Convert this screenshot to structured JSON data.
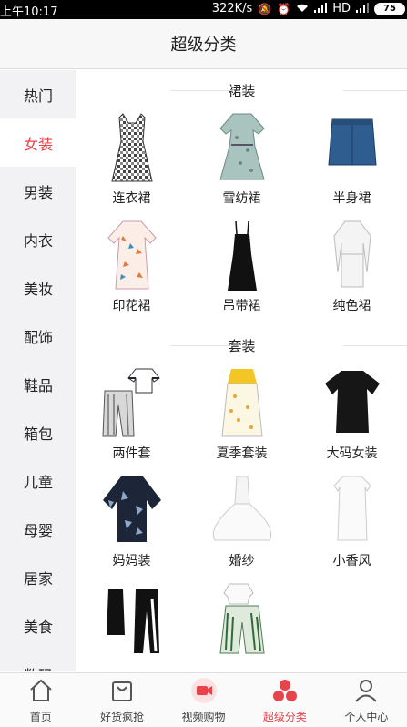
{
  "status": {
    "time": "上午10:17",
    "net_speed": "322K/s",
    "network": "HD",
    "battery": "75"
  },
  "header": {
    "title": "超级分类"
  },
  "sidebar": {
    "items": [
      {
        "label": "热门"
      },
      {
        "label": "女装",
        "active": true
      },
      {
        "label": "男装"
      },
      {
        "label": "内衣"
      },
      {
        "label": "美妆"
      },
      {
        "label": "配饰"
      },
      {
        "label": "鞋品"
      },
      {
        "label": "箱包"
      },
      {
        "label": "儿童"
      },
      {
        "label": "母婴"
      },
      {
        "label": "居家"
      },
      {
        "label": "美食"
      },
      {
        "label": "数码"
      }
    ]
  },
  "sections": [
    {
      "title": "裙装",
      "items": [
        {
          "label": "连衣裙",
          "icon": "gingham-dress-icon"
        },
        {
          "label": "雪纺裙",
          "icon": "chiffon-dress-icon"
        },
        {
          "label": "半身裙",
          "icon": "denim-skirt-icon"
        },
        {
          "label": "印花裙",
          "icon": "print-dress-icon"
        },
        {
          "label": "吊带裙",
          "icon": "slip-dress-icon"
        },
        {
          "label": "纯色裙",
          "icon": "white-dress-icon"
        }
      ]
    },
    {
      "title": "套装",
      "items": [
        {
          "label": "两件套",
          "icon": "two-piece-set-icon"
        },
        {
          "label": "夏季套装",
          "icon": "summer-set-icon"
        },
        {
          "label": "大码女装",
          "icon": "black-tee-icon"
        },
        {
          "label": "妈妈装",
          "icon": "mom-blouse-icon"
        },
        {
          "label": "婚纱",
          "icon": "wedding-gown-icon"
        },
        {
          "label": "小香风",
          "icon": "white-tweed-dress-icon"
        },
        {
          "label": "",
          "icon": "sport-set-icon"
        },
        {
          "label": "",
          "icon": "wide-pants-set-icon"
        }
      ]
    }
  ],
  "tabbar": {
    "items": [
      {
        "label": "首页",
        "icon": "home-icon"
      },
      {
        "label": "好货疯抢",
        "icon": "bag-icon"
      },
      {
        "label": "视频购物",
        "icon": "video-camera-icon"
      },
      {
        "label": "超级分类",
        "icon": "category-dots-icon",
        "active": true
      },
      {
        "label": "个人中心",
        "icon": "user-icon"
      }
    ]
  },
  "colors": {
    "accent": "#e8434b",
    "sidebar_bg": "#f2f2f4",
    "header_bg": "#f7f7f7"
  }
}
